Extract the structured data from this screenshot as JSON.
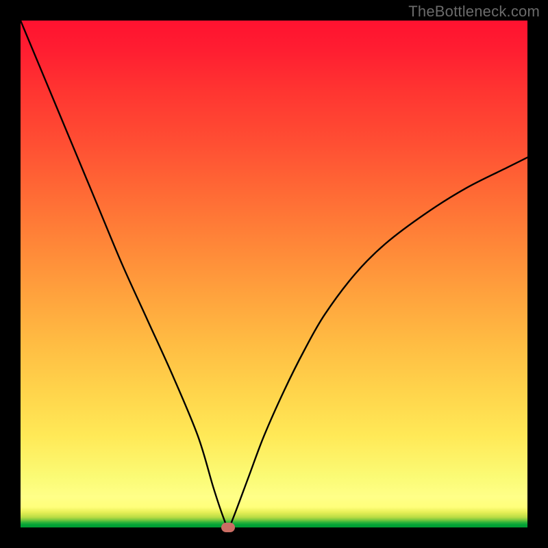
{
  "watermark": "TheBottleneck.com",
  "chart_data": {
    "type": "line",
    "title": "",
    "xlabel": "",
    "ylabel": "",
    "xlim": [
      0,
      100
    ],
    "ylim": [
      0,
      100
    ],
    "grid": false,
    "legend": false,
    "background": {
      "gradient": "vertical",
      "top_color": "#ff1230",
      "bottom_color": "#009a33",
      "meaning": "red = bottleneck, green = balanced"
    },
    "series": [
      {
        "name": "bottleneck-curve",
        "color": "#000000",
        "x": [
          0,
          5,
          10,
          15,
          20,
          25,
          30,
          35,
          38,
          40,
          41,
          42,
          45,
          48,
          52,
          56,
          60,
          66,
          72,
          80,
          88,
          96,
          100
        ],
        "values": [
          100,
          88,
          76,
          64,
          52,
          41,
          30,
          18,
          8,
          2,
          0,
          2,
          10,
          18,
          27,
          35,
          42,
          50,
          56,
          62,
          67,
          71,
          73
        ]
      }
    ],
    "marker": {
      "name": "optimal-point",
      "x": 41,
      "y": 0,
      "color": "#cc6e64"
    }
  },
  "plot_geometry": {
    "inner_left": 30,
    "inner_top": 30,
    "inner_width": 740,
    "inner_height": 740
  }
}
